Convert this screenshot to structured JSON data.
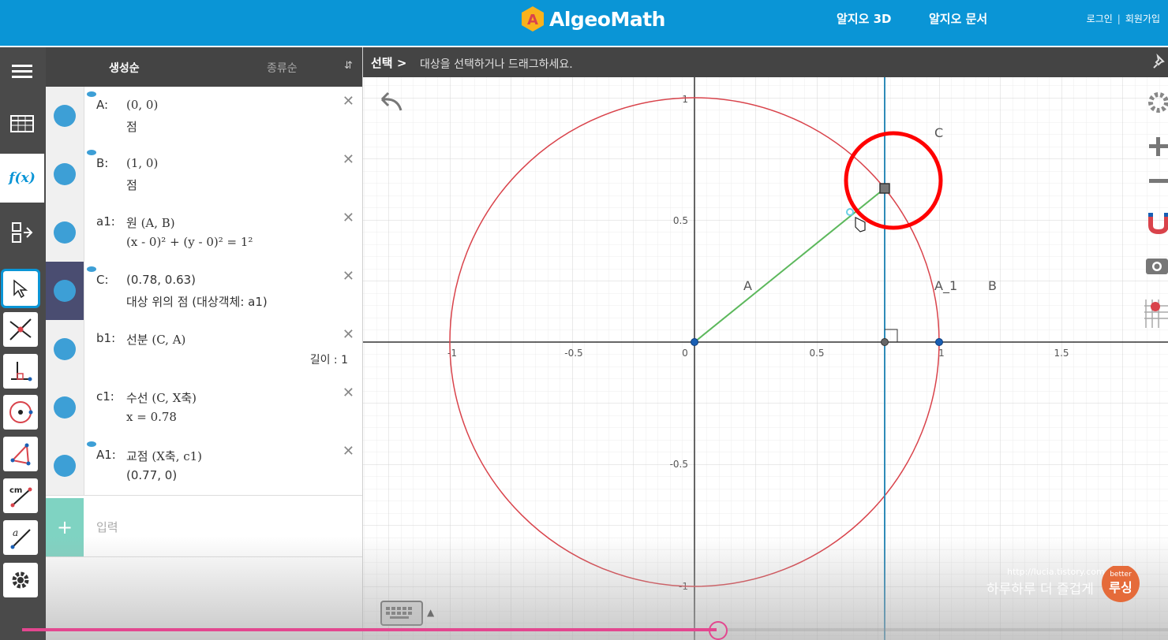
{
  "header": {
    "logo_text": "AlgeoMath",
    "nav": [
      "알지오 3D",
      "알지오 문서"
    ],
    "login": "로그인",
    "separator": "|",
    "signup": "회원가입"
  },
  "algebra_panel": {
    "sort_by_creation": "생성순",
    "sort_by_type": "종류순",
    "sort_icon": "⇵",
    "items": [
      {
        "label": "A:",
        "definition": "(0, 0)",
        "description": "점",
        "visible": true
      },
      {
        "label": "B:",
        "definition": "(1, 0)",
        "description": "점",
        "visible": true
      },
      {
        "label": "a1:",
        "definition": "원 (A, B)",
        "description": "(x - 0)² + (y - 0)² = 1²",
        "visible": false
      },
      {
        "label": "C:",
        "definition": "(0.78, 0.63)",
        "description": "대상 위의 점 (대상객체: a1)",
        "visible": true,
        "selected": true
      },
      {
        "label": "b1:",
        "definition": "선분 (C, A)",
        "length": "길이 : 1",
        "visible": false
      },
      {
        "label": "c1:",
        "definition": "수선 (C, X축)",
        "description": "x = 0.78",
        "visible": false
      },
      {
        "label": "A1:",
        "definition": "교점 (X축, c1)",
        "description": "(0.77, 0)",
        "visible": true
      }
    ],
    "input_placeholder": "입력",
    "close_glyph": "✕"
  },
  "hint_bar": {
    "mode": "선택",
    "arrow": ">",
    "message": "대상을 선택하거나 드래그하세요."
  },
  "graph": {
    "x_ticks": [
      "-1",
      "-0.5",
      "0",
      "0.5",
      "1",
      "1.5"
    ],
    "y_ticks": [
      "1",
      "0.5",
      "-0.5",
      "-1"
    ],
    "labels": {
      "C": "C",
      "A": "A",
      "A_1": "A_1",
      "B": "B"
    },
    "colors": {
      "circle": "#d9434b",
      "segment": "#5cb85c",
      "perpendicular": "#2f8bb8",
      "highlight": "#ff0000",
      "point": "#1a5fb4"
    }
  },
  "watermark": {
    "url": "http://lucia.tistory.com",
    "slogan": "하루하루 더 즐겁게",
    "badge": "better",
    "brand": "루싱"
  }
}
